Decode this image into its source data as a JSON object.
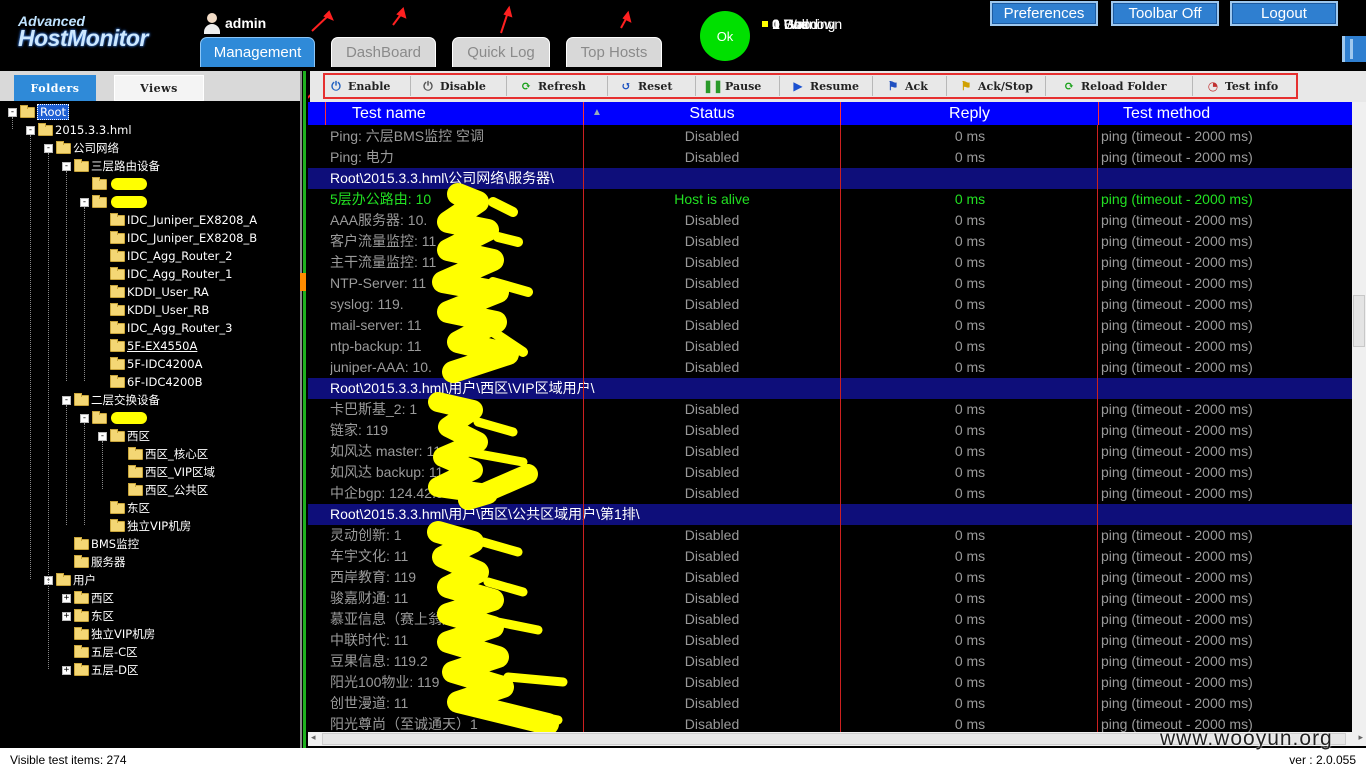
{
  "app": {
    "logo_line1": "Advanced",
    "logo_line2": "HostMonitor"
  },
  "user": {
    "name": "admin"
  },
  "tabs": [
    {
      "label": "Management",
      "active": true
    },
    {
      "label": "DashBoard",
      "active": false
    },
    {
      "label": "Quick Log",
      "active": false
    },
    {
      "label": "Top Hosts",
      "active": false
    }
  ],
  "status_circle": "Ok",
  "counts": [
    {
      "num": "1",
      "label": "Good",
      "color": "#00d000"
    },
    {
      "num": "0",
      "label": "Bad",
      "color": "#e00000"
    },
    {
      "num": "0",
      "label": "Warning",
      "color": "#ffb0b0"
    },
    {
      "num": "0",
      "label": "Unknown",
      "color": "#ffff00"
    }
  ],
  "top_buttons": {
    "preferences": "Preferences",
    "toolbar": "Toolbar Off",
    "logout": "Logout"
  },
  "left_tabs": {
    "folders": "Folders",
    "views": "Views"
  },
  "tree": [
    {
      "label": "Root",
      "level": 0,
      "exp": "-",
      "sel": true
    },
    {
      "label": "2015.3.3.hml",
      "level": 1,
      "exp": "-"
    },
    {
      "label": "公司网络",
      "level": 2,
      "exp": "-"
    },
    {
      "label": "三层路由设备",
      "level": 3,
      "exp": "-"
    },
    {
      "label": "",
      "level": 4,
      "exp": "",
      "blot": true
    },
    {
      "label": "",
      "level": 4,
      "exp": "-",
      "blot": true
    },
    {
      "label": "IDC_Juniper_EX8208_A",
      "level": 5,
      "exp": ""
    },
    {
      "label": "IDC_Juniper_EX8208_B",
      "level": 5,
      "exp": ""
    },
    {
      "label": "IDC_Agg_Router_2",
      "level": 5,
      "exp": ""
    },
    {
      "label": "IDC_Agg_Router_1",
      "level": 5,
      "exp": ""
    },
    {
      "label": "KDDI_User_RA",
      "level": 5,
      "exp": ""
    },
    {
      "label": "KDDI_User_RB",
      "level": 5,
      "exp": ""
    },
    {
      "label": "IDC_Agg_Router_3",
      "level": 5,
      "exp": ""
    },
    {
      "label": "5F-EX4550A",
      "level": 5,
      "exp": "",
      "u": true
    },
    {
      "label": "5F-IDC4200A",
      "level": 5,
      "exp": ""
    },
    {
      "label": "6F-IDC4200B",
      "level": 5,
      "exp": ""
    },
    {
      "label": "二层交换设备",
      "level": 3,
      "exp": "-"
    },
    {
      "label": "",
      "level": 4,
      "exp": "-",
      "blot": true
    },
    {
      "label": "西区",
      "level": 5,
      "exp": "-"
    },
    {
      "label": "西区_核心区",
      "level": 6,
      "exp": ""
    },
    {
      "label": "西区_VIP区域",
      "level": 6,
      "exp": ""
    },
    {
      "label": "西区_公共区",
      "level": 6,
      "exp": ""
    },
    {
      "label": "东区",
      "level": 5,
      "exp": ""
    },
    {
      "label": "独立VIP机房",
      "level": 5,
      "exp": ""
    },
    {
      "label": "BMS监控",
      "level": 3,
      "exp": ""
    },
    {
      "label": "服务器",
      "level": 3,
      "exp": ""
    },
    {
      "label": "用户",
      "level": 2,
      "exp": "-"
    },
    {
      "label": "西区",
      "level": 3,
      "exp": "+"
    },
    {
      "label": "东区",
      "level": 3,
      "exp": "+"
    },
    {
      "label": "独立VIP机房",
      "level": 3,
      "exp": ""
    },
    {
      "label": "五层-C区",
      "level": 3,
      "exp": ""
    },
    {
      "label": "五层-D区",
      "level": 3,
      "exp": "+"
    }
  ],
  "toolbar": [
    {
      "label": "Enable",
      "icon": "power-icon",
      "glyph": "⏻",
      "color": "#2060c0"
    },
    {
      "label": "Disable",
      "icon": "power-off-icon",
      "glyph": "⏻",
      "color": "#555"
    },
    {
      "label": "Refresh",
      "icon": "refresh-icon",
      "glyph": "⟳",
      "color": "#18a018"
    },
    {
      "label": "Reset",
      "icon": "reset-icon",
      "glyph": "↺",
      "color": "#1a50c0"
    },
    {
      "label": "Pause",
      "icon": "pause-icon",
      "glyph": "❚❚",
      "color": "#2a9a2a"
    },
    {
      "label": "Resume",
      "icon": "play-icon",
      "glyph": "▶",
      "color": "#1a50d0"
    },
    {
      "label": "Ack",
      "icon": "flag-icon",
      "glyph": "⚑",
      "color": "#2050c0"
    },
    {
      "label": "Ack/Stop",
      "icon": "flag-stop-icon",
      "glyph": "⚑",
      "color": "#d0a000"
    },
    {
      "label": "Reload Folder",
      "icon": "reload-folder-icon",
      "glyph": "⟳",
      "color": "#18a018"
    },
    {
      "label": "Test info",
      "icon": "info-chart-icon",
      "glyph": "◔",
      "color": "#c03030"
    }
  ],
  "grid": {
    "headers": [
      "Test name",
      "Status",
      "Reply",
      "Test method"
    ],
    "rows": [
      {
        "type": "d",
        "name": "Ping: 六层BMS监控 空调",
        "status": "Disabled",
        "reply": "0 ms",
        "method": "ping (timeout - 2000 ms)"
      },
      {
        "type": "d",
        "name": "Ping: 电力",
        "status": "Disabled",
        "reply": "0 ms",
        "method": "ping (timeout - 2000 ms)"
      },
      {
        "type": "g",
        "name": "Root\\2015.3.3.hml\\公司网络\\服务器\\"
      },
      {
        "type": "a",
        "name": "5层办公路由: 10",
        "status": "Host is alive",
        "reply": "0 ms",
        "method": "ping (timeout - 2000 ms)"
      },
      {
        "type": "d",
        "name": "AAA服务器: 10.",
        "status": "Disabled",
        "reply": "0 ms",
        "method": "ping (timeout - 2000 ms)"
      },
      {
        "type": "d",
        "name": "客户流量监控: 11",
        "status": "Disabled",
        "reply": "0 ms",
        "method": "ping (timeout - 2000 ms)"
      },
      {
        "type": "d",
        "name": "主干流量监控: 11",
        "status": "Disabled",
        "reply": "0 ms",
        "method": "ping (timeout - 2000 ms)"
      },
      {
        "type": "d",
        "name": "NTP-Server: 11",
        "status": "Disabled",
        "reply": "0 ms",
        "method": "ping (timeout - 2000 ms)"
      },
      {
        "type": "d",
        "name": "syslog: 119.",
        "status": "Disabled",
        "reply": "0 ms",
        "method": "ping (timeout - 2000 ms)"
      },
      {
        "type": "d",
        "name": "mail-server: 11",
        "status": "Disabled",
        "reply": "0 ms",
        "method": "ping (timeout - 2000 ms)"
      },
      {
        "type": "d",
        "name": "ntp-backup: 11",
        "status": "Disabled",
        "reply": "0 ms",
        "method": "ping (timeout - 2000 ms)"
      },
      {
        "type": "d",
        "name": "juniper-AAA: 10.",
        "status": "Disabled",
        "reply": "0 ms",
        "method": "ping (timeout - 2000 ms)"
      },
      {
        "type": "g",
        "name": "Root\\2015.3.3.hml\\用户\\西区\\VIP区域用户\\"
      },
      {
        "type": "d",
        "name": "卡巴斯基_2: 1",
        "status": "Disabled",
        "reply": "0 ms",
        "method": "ping (timeout - 2000 ms)"
      },
      {
        "type": "d",
        "name": "链家: 119",
        "status": "Disabled",
        "reply": "0 ms",
        "method": "ping (timeout - 2000 ms)"
      },
      {
        "type": "d",
        "name": "如风达 master: 11",
        "status": "Disabled",
        "reply": "0 ms",
        "method": "ping (timeout - 2000 ms)"
      },
      {
        "type": "d",
        "name": "如风达 backup: 11",
        "status": "Disabled",
        "reply": "0 ms",
        "method": "ping (timeout - 2000 ms)"
      },
      {
        "type": "d",
        "name": "中企bgp: 124.42.50.190",
        "status": "Disabled",
        "reply": "0 ms",
        "method": "ping (timeout - 2000 ms)"
      },
      {
        "type": "g",
        "name": "Root\\2015.3.3.hml\\用户\\西区\\公共区域用户\\第1排\\"
      },
      {
        "type": "d",
        "name": "灵动创新: 1",
        "status": "Disabled",
        "reply": "0 ms",
        "method": "ping (timeout - 2000 ms)"
      },
      {
        "type": "d",
        "name": "车宇文化: 11",
        "status": "Disabled",
        "reply": "0 ms",
        "method": "ping (timeout - 2000 ms)"
      },
      {
        "type": "d",
        "name": "西岸教育: 119",
        "status": "Disabled",
        "reply": "0 ms",
        "method": "ping (timeout - 2000 ms)"
      },
      {
        "type": "d",
        "name": "骏嘉财通: 11",
        "status": "Disabled",
        "reply": "0 ms",
        "method": "ping (timeout - 2000 ms)"
      },
      {
        "type": "d",
        "name": "慕亚信息（赛上翁）:",
        "status": "Disabled",
        "reply": "0 ms",
        "method": "ping (timeout - 2000 ms)"
      },
      {
        "type": "d",
        "name": "中联时代: 11",
        "status": "Disabled",
        "reply": "0 ms",
        "method": "ping (timeout - 2000 ms)"
      },
      {
        "type": "d",
        "name": "豆果信息: 119.2",
        "status": "Disabled",
        "reply": "0 ms",
        "method": "ping (timeout - 2000 ms)"
      },
      {
        "type": "d",
        "name": "阳光100物业: 119",
        "status": "Disabled",
        "reply": "0 ms",
        "method": "ping (timeout - 2000 ms)"
      },
      {
        "type": "d",
        "name": "创世漫道: 11",
        "status": "Disabled",
        "reply": "0 ms",
        "method": "ping (timeout - 2000 ms)"
      },
      {
        "type": "d",
        "name": "阳光尊尚（至诚通天）1",
        "status": "Disabled",
        "reply": "0 ms",
        "method": "ping (timeout - 2000 ms)"
      }
    ]
  },
  "statusbar": {
    "left": "Visible test items: 274",
    "right": "ver : 2.0.055"
  },
  "watermark": "www.wooyun.org"
}
